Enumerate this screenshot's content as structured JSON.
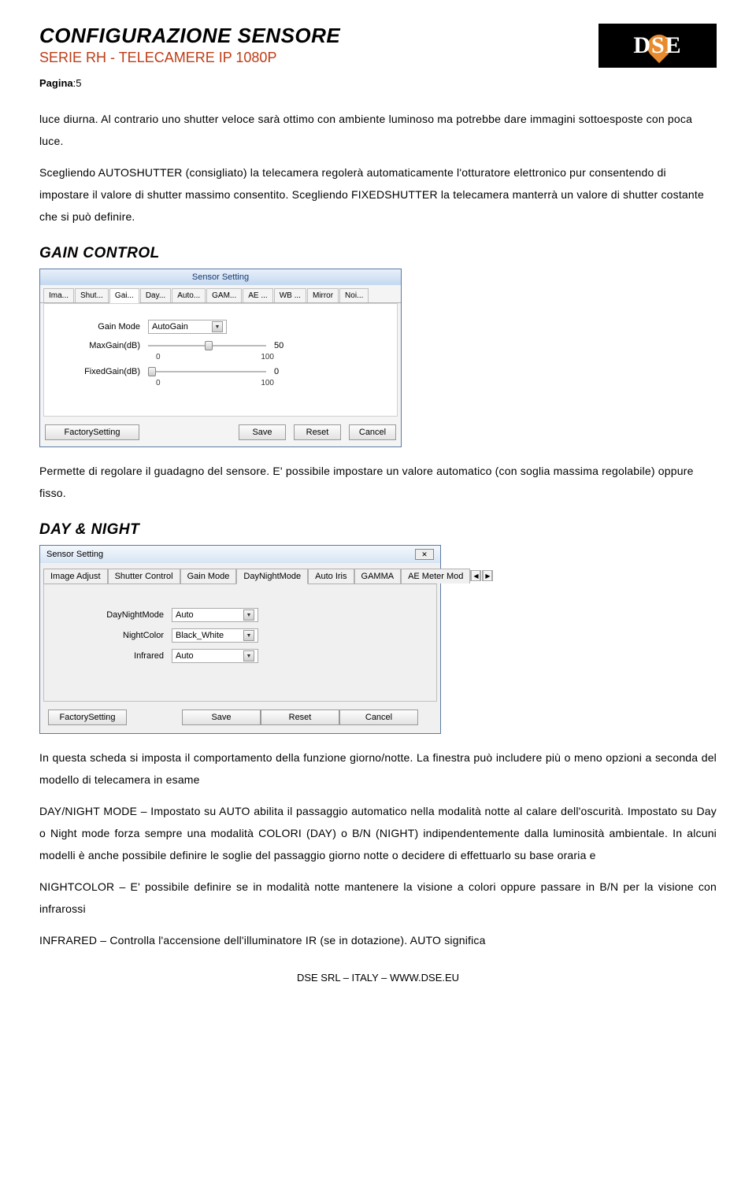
{
  "header": {
    "title": "CONFIGURAZIONE SENSORE",
    "subtitle": "SERIE RH - TELECAMERE IP 1080P",
    "pagina_label": "Pagina",
    "pagina_num": ":5",
    "logo_text": "DSE"
  },
  "para1": "luce diurna. Al contrario uno shutter veloce sarà ottimo con ambiente luminoso ma potrebbe dare immagini sottoesposte con poca luce.",
  "para2": "Scegliendo AUTOSHUTTER (consigliato) la telecamera regolerà automaticamente l'otturatore elettronico pur consentendo di impostare il valore di shutter massimo consentito. Scegliendo FIXEDSHUTTER la telecamera manterrà un valore di shutter costante che si può definire.",
  "gain_heading": "GAIN CONTROL",
  "gain_dialog": {
    "title": "Sensor Setting",
    "tabs": [
      "Ima...",
      "Shut...",
      "Gai...",
      "Day...",
      "Auto...",
      "GAM...",
      "AE ...",
      "WB ...",
      "Mirror",
      "Noi..."
    ],
    "active_tab_index": 2,
    "gain_mode_label": "Gain Mode",
    "gain_mode_value": "AutoGain",
    "maxgain_label": "MaxGain(dB)",
    "maxgain_value": "50",
    "maxgain_min": "0",
    "maxgain_max": "100",
    "fixedgain_label": "FixedGain(dB)",
    "fixedgain_value": "0",
    "fixedgain_min": "0",
    "fixedgain_max": "100",
    "btn_factory": "FactorySetting",
    "btn_save": "Save",
    "btn_reset": "Reset",
    "btn_cancel": "Cancel"
  },
  "gain_para": "Permette di regolare il guadagno del sensore. E' possibile impostare un valore automatico (con soglia massima regolabile) oppure fisso.",
  "daynight_heading": "DAY & NIGHT",
  "daynight_dialog": {
    "title": "Sensor Setting",
    "close": "✕",
    "tabs": [
      "Image Adjust",
      "Shutter Control",
      "Gain Mode",
      "DayNightMode",
      "Auto Iris",
      "GAMMA",
      "AE Meter Mod"
    ],
    "active_tab_index": 3,
    "nav_left": "◀",
    "nav_right": "▶",
    "mode_label": "DayNightMode",
    "mode_value": "Auto",
    "nightcolor_label": "NightColor",
    "nightcolor_value": "Black_White",
    "infrared_label": "Infrared",
    "infrared_value": "Auto",
    "btn_factory": "FactorySetting",
    "btn_save": "Save",
    "btn_reset": "Reset",
    "btn_cancel": "Cancel"
  },
  "dn_para1": "In questa scheda si imposta il comportamento della funzione giorno/notte. La finestra può includere più o meno opzioni a seconda del modello di telecamera in esame",
  "dn_para2": "DAY/NIGHT MODE – Impostato su AUTO abilita il passaggio automatico nella modalità notte al calare dell'oscurità. Impostato su Day o Night mode forza sempre una modalità COLORI (DAY) o B/N (NIGHT) indipendentemente dalla luminosità ambientale. In alcuni modelli è anche possibile definire le soglie del passaggio giorno notte o decidere di effettuarlo su base oraria e",
  "dn_para3": "NIGHTCOLOR – E' possibile definire se in modalità notte mantenere la visione a colori oppure passare in B/N per la visione con infrarossi",
  "dn_para4": "INFRARED – Controlla l'accensione dell'illuminatore IR (se in dotazione). AUTO significa",
  "footer": "DSE SRL – ITALY – WWW.DSE.EU"
}
